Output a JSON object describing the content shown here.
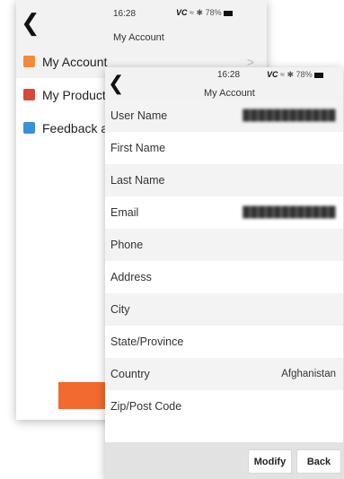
{
  "back_screen": {
    "status": {
      "time": "16:28",
      "carrier": "VC",
      "battery": "78%"
    },
    "title": "My Account",
    "menu": [
      {
        "label": "My Account",
        "icon": "account-icon"
      },
      {
        "label": "My Products",
        "icon": "products-icon"
      },
      {
        "label": "Feedback and",
        "icon": "feedback-icon"
      }
    ],
    "chevron": ">"
  },
  "front_screen": {
    "status": {
      "time": "16:28",
      "carrier": "VC",
      "battery": "78%"
    },
    "title": "My Account",
    "fields": [
      {
        "label": "User Name",
        "value": "████████████"
      },
      {
        "label": "First Name",
        "value": ""
      },
      {
        "label": "Last Name",
        "value": ""
      },
      {
        "label": "Email",
        "value": "████████████"
      },
      {
        "label": "Phone",
        "value": ""
      },
      {
        "label": "Address",
        "value": ""
      },
      {
        "label": "City",
        "value": ""
      },
      {
        "label": "State/Province",
        "value": ""
      },
      {
        "label": "Country",
        "value": "Afghanistan"
      },
      {
        "label": "Zip/Post Code",
        "value": ""
      }
    ],
    "buttons": {
      "modify": "Modify",
      "back": "Back"
    }
  }
}
